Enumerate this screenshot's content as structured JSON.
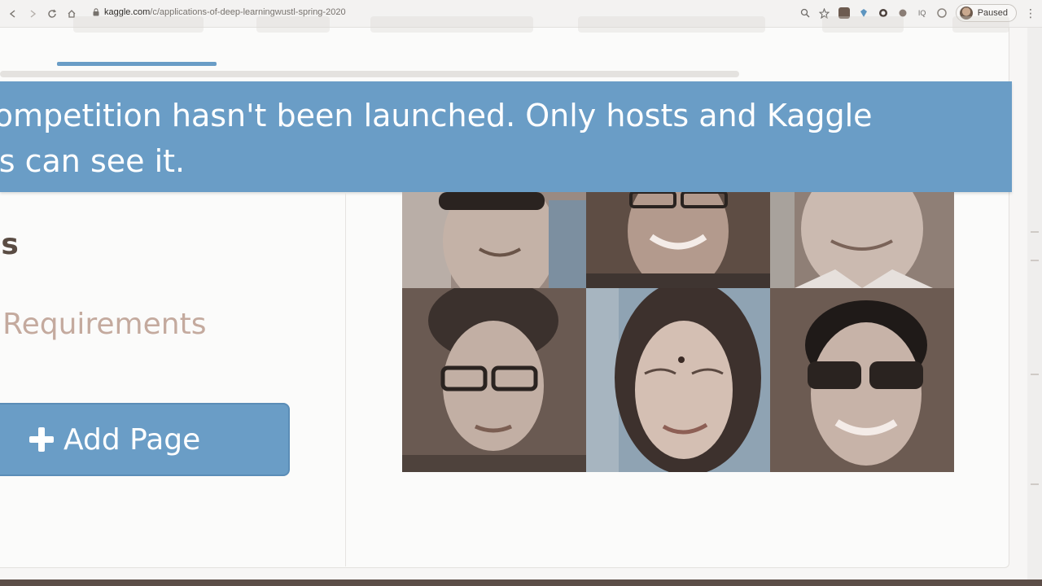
{
  "browser": {
    "url_host": "kaggle.com",
    "url_path": "/c/applications-of-deep-learningwustl-spring-2020",
    "profile_label": "Paused",
    "icons": [
      "back-icon",
      "forward-icon",
      "reload-icon",
      "home-icon",
      "lock-icon",
      "zoom-icon",
      "star-icon",
      "extension-icon",
      "profile-avatar",
      "menu-icon"
    ]
  },
  "banner": {
    "message": "s competition hasn't been launched. Only hosts and Kaggle\nnins can see it."
  },
  "left": {
    "heading": "zes",
    "requirements_link": "nels Requirements",
    "add_page_label": "Add Page"
  },
  "image": {
    "description_name": "face-grid-image"
  },
  "colors": {
    "accent_blue": "#6a9dc6",
    "heading_brown": "#5a4c43",
    "link_tan": "#c4aa9e",
    "photo_sepia": "#6b5a50"
  }
}
